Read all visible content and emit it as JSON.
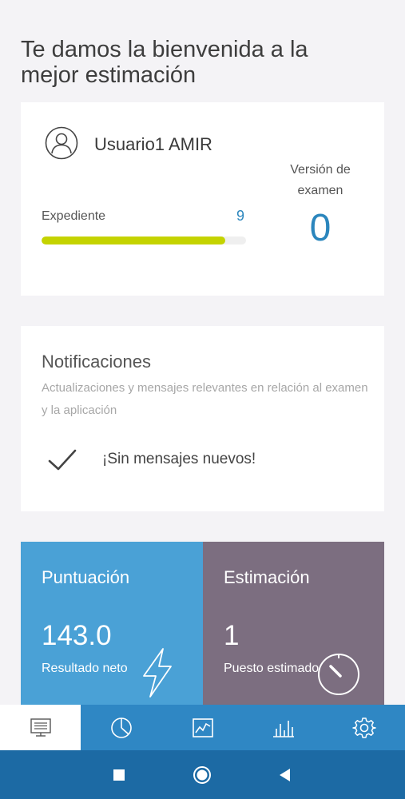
{
  "welcome": "Te damos la bienvenida a la mejor estimación",
  "user": {
    "name": "Usuario1 AMIR",
    "avatar_icon": "user-circle-icon",
    "expediente_label": "Expediente",
    "expediente_value": "9",
    "expediente_progress": 0.9,
    "version_label": "Versión de examen",
    "version_value": "0"
  },
  "notifications": {
    "title": "Notificaciones",
    "subtitle": "Actualizaciones y mensajes relevantes en relación al examen y la aplicación",
    "check_icon": "check-icon",
    "empty_message": "¡Sin mensajes nuevos!"
  },
  "tiles": {
    "score": {
      "title": "Puntuación",
      "value": "143.0",
      "caption": "Resultado neto",
      "icon": "lightning-icon",
      "color": "#4aa1d6"
    },
    "estimate": {
      "title": "Estimación",
      "value": "1",
      "caption": "Puesto estimado",
      "icon": "stopwatch-icon",
      "color": "#7c6e80"
    }
  },
  "tabs": [
    {
      "icon": "dashboard-icon",
      "active": true
    },
    {
      "icon": "pie-chart-icon",
      "active": false
    },
    {
      "icon": "line-chart-icon",
      "active": false
    },
    {
      "icon": "bar-chart-icon",
      "active": false
    },
    {
      "icon": "gear-icon",
      "active": false
    }
  ],
  "android_nav": [
    "recents-icon",
    "home-icon",
    "back-icon"
  ],
  "colors": {
    "accent": "#2b86bd",
    "progress": "#c4d300",
    "tabbar": "#2f87c4",
    "navbar": "#1c6aa4"
  }
}
